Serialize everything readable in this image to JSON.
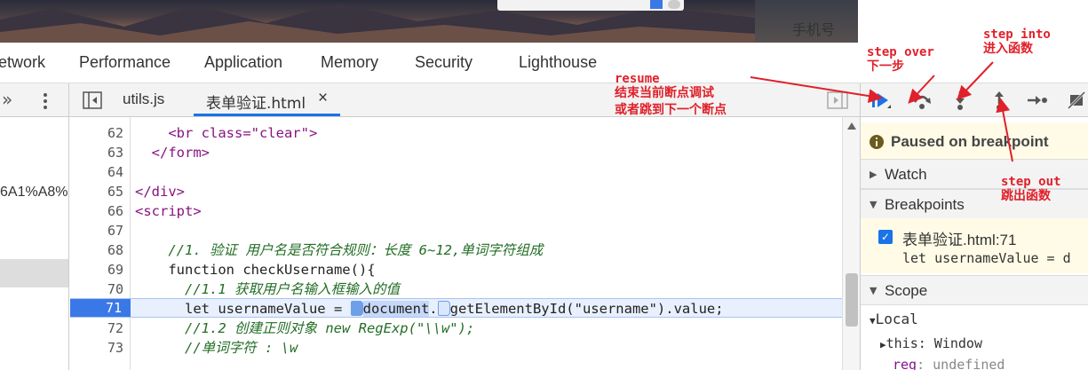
{
  "page": {
    "phone_label": "手机号"
  },
  "devtools_tabs": [
    "etwork",
    "Performance",
    "Application",
    "Memory",
    "Security",
    "Lighthouse"
  ],
  "file_tabs": {
    "more": "»",
    "file1": "utils.js",
    "file2": "表单验证.html",
    "close": "×"
  },
  "navigator": {
    "url_fragment": "6A1%A8%"
  },
  "editor": {
    "lines": [
      {
        "num": "62",
        "code": "    <br class=\"clear\">"
      },
      {
        "num": "63",
        "code": "  </form>"
      },
      {
        "num": "64",
        "code": ""
      },
      {
        "num": "65",
        "code": "</div>"
      },
      {
        "num": "66",
        "code": "<script>"
      },
      {
        "num": "67",
        "code": ""
      },
      {
        "num": "68",
        "code": "    //1. 验证 用户名是否符合规则：长度 6~12,单词字符组成"
      },
      {
        "num": "69",
        "code": "    function checkUsername(){"
      },
      {
        "num": "70",
        "code": "      //1.1 获取用户名输入框输入的值"
      },
      {
        "num": "71",
        "code": "      let usernameValue = "
      },
      {
        "num": "72",
        "code": "      //1.2 创建正则对象 new RegExp(\"\\\\w\");"
      },
      {
        "num": "73",
        "code": "      //单词字符 : \\w"
      }
    ],
    "line71_part1": "document",
    "line71_dot": ".",
    "line71_part2": "getElementById(\"username\").value;"
  },
  "debugger": {
    "paused_label": "Paused on breakpoint",
    "sections": {
      "watch": "Watch",
      "breakpoints": "Breakpoints",
      "scope": "Scope"
    },
    "breakpoint_file": "表单验证.html:71",
    "breakpoint_code": "let usernameValue = d",
    "scope_local": "Local",
    "this_key": "this",
    "this_value": ": Window",
    "reg_key": "reg",
    "reg_value": ": undefined"
  },
  "annotations": {
    "resume_en": "resume",
    "resume_zh1": "结束当前断点调试",
    "resume_zh2": "或者跳到下一个断点",
    "step_over_en": "step over",
    "step_over_zh": "下一步",
    "step_into_en": "step into",
    "step_into_zh": "进入函数",
    "step_out_en": "step out",
    "step_out_zh": "跳出函数"
  },
  "colors": {
    "accent": "#1a73e8",
    "annotation": "#e0202a",
    "paused_bg": "#fffbe6"
  }
}
